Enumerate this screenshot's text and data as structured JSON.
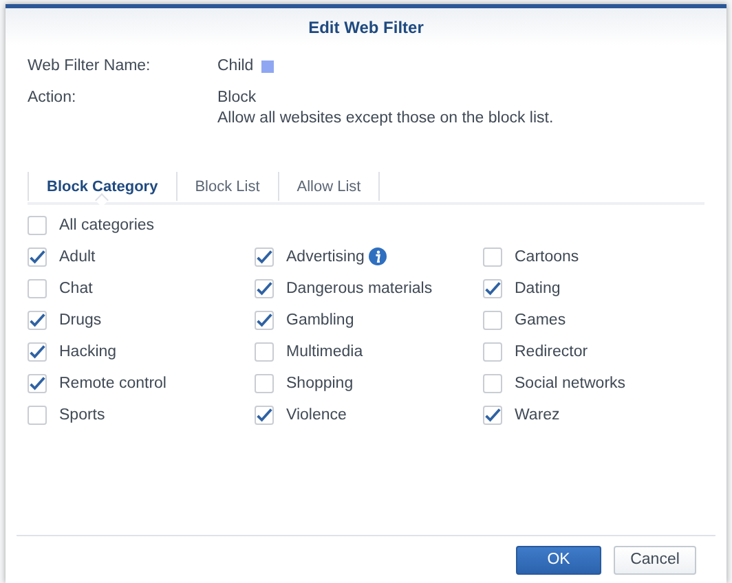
{
  "dialog": {
    "title": "Edit Web Filter"
  },
  "fields": [
    {
      "label": "Web Filter Name:",
      "value": "Child",
      "color": "#8fa6f2"
    },
    {
      "label": "Action:",
      "value": "Block",
      "description": "Allow all websites except those on the block list."
    }
  ],
  "tabs": [
    {
      "label": "Block Category",
      "selected": true
    },
    {
      "label": "Block List",
      "selected": false
    },
    {
      "label": "Allow List",
      "selected": false
    }
  ],
  "all_categories": {
    "label": "All categories",
    "checked": false
  },
  "categories": [
    {
      "label": "Adult",
      "checked": true,
      "info": false
    },
    {
      "label": "Advertising",
      "checked": true,
      "info": true
    },
    {
      "label": "Cartoons",
      "checked": false,
      "info": false
    },
    {
      "label": "Chat",
      "checked": false,
      "info": false
    },
    {
      "label": "Dangerous materials",
      "checked": true,
      "info": false
    },
    {
      "label": "Dating",
      "checked": true,
      "info": false
    },
    {
      "label": "Drugs",
      "checked": true,
      "info": false
    },
    {
      "label": "Gambling",
      "checked": true,
      "info": false
    },
    {
      "label": "Games",
      "checked": false,
      "info": false
    },
    {
      "label": "Hacking",
      "checked": true,
      "info": false
    },
    {
      "label": "Multimedia",
      "checked": false,
      "info": false
    },
    {
      "label": "Redirector",
      "checked": false,
      "info": false
    },
    {
      "label": "Remote control",
      "checked": true,
      "info": false
    },
    {
      "label": "Shopping",
      "checked": false,
      "info": false
    },
    {
      "label": "Social networks",
      "checked": false,
      "info": false
    },
    {
      "label": "Sports",
      "checked": false,
      "info": false
    },
    {
      "label": "Violence",
      "checked": true,
      "info": false
    },
    {
      "label": "Warez",
      "checked": true,
      "info": false
    }
  ],
  "buttons": [
    {
      "label": "OK",
      "kind": "primary"
    },
    {
      "label": "Cancel",
      "kind": "secondary"
    }
  ]
}
